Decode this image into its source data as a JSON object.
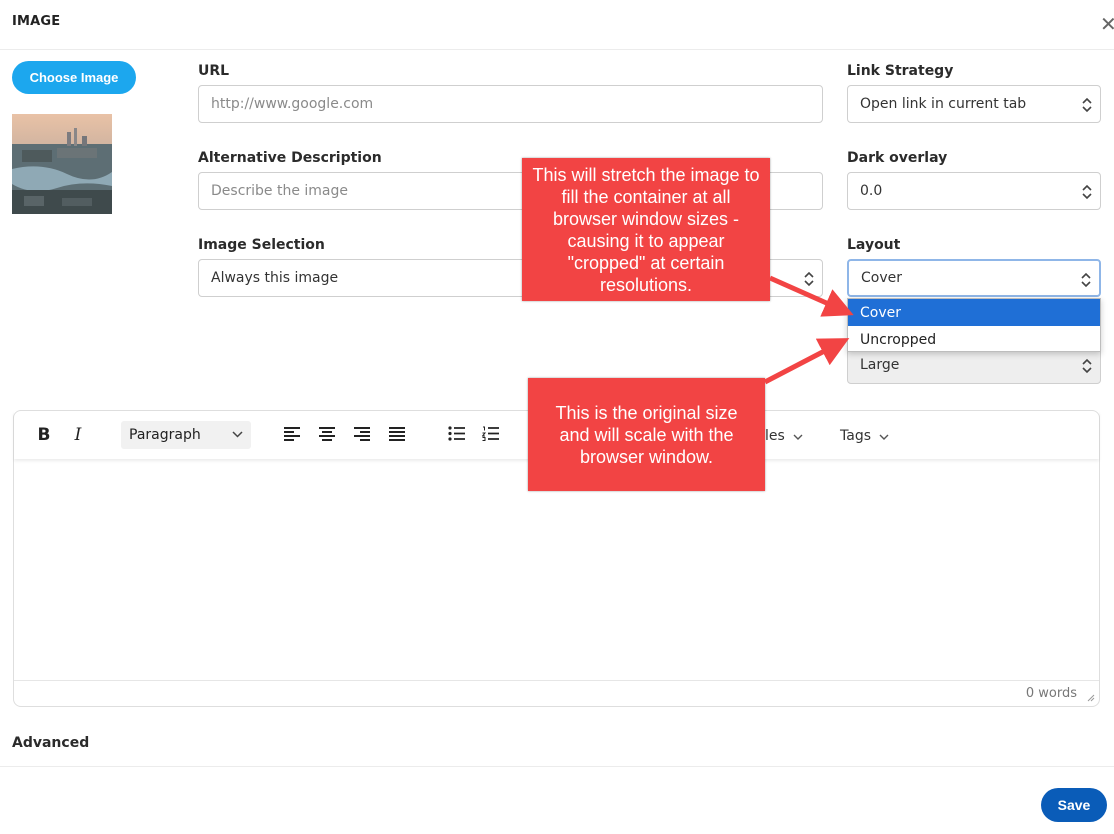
{
  "header": {
    "title": "IMAGE",
    "close_glyph": "✕"
  },
  "choose_image_label": "Choose Image",
  "thumbnail": {
    "icon": "city-photo-thumbnail"
  },
  "url": {
    "label": "URL",
    "placeholder": "http://www.google.com"
  },
  "alt": {
    "label": "Alternative Description",
    "placeholder": "Describe the image"
  },
  "image_selection": {
    "label": "Image Selection",
    "value": "Always this image"
  },
  "link_strategy": {
    "label": "Link Strategy",
    "value": "Open link in current tab"
  },
  "dark_overlay": {
    "label": "Dark overlay",
    "value": "0.0"
  },
  "layout": {
    "label": "Layout",
    "value": "Cover",
    "options": [
      "Cover",
      "Uncropped"
    ],
    "selected_index": 0
  },
  "size_select": {
    "value": "Large"
  },
  "editor": {
    "bold": "B",
    "italic": "I",
    "paragraph": "Paragraph",
    "styles_menu": "les",
    "tags_menu": "Tags",
    "word_count": "0 words"
  },
  "advanced_label": "Advanced",
  "save_label": "Save",
  "callouts": {
    "cover_note": "This will stretch the image to fill the container at all browser window sizes - causing it to appear \"cropped\" at certain resolutions.",
    "uncropped_note": "This is the original size and will scale with the browser window."
  },
  "colors": {
    "accent_blue": "#1ca7ee",
    "save_blue": "#0a5cb8",
    "callout_red": "#f24444",
    "dropdown_selected": "#1f6fd6"
  }
}
